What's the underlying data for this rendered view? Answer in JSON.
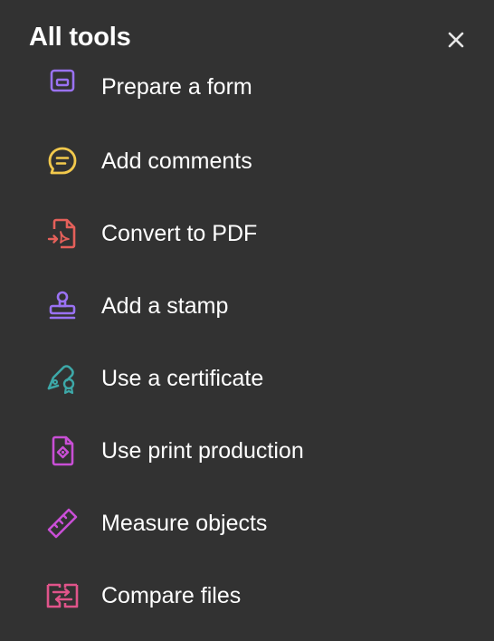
{
  "panel": {
    "title": "All tools",
    "close_icon": "close-icon"
  },
  "tools": [
    {
      "label": "Prepare a form",
      "icon": "prepare-form-icon",
      "color": "#9A72F3"
    },
    {
      "label": "Add comments",
      "icon": "comment-icon",
      "color": "#F2C94C"
    },
    {
      "label": "Convert to PDF",
      "icon": "convert-pdf-icon",
      "color": "#E5605A"
    },
    {
      "label": "Add a stamp",
      "icon": "stamp-icon",
      "color": "#9A72F3"
    },
    {
      "label": "Use a certificate",
      "icon": "certificate-icon",
      "color": "#3DA8A8"
    },
    {
      "label": "Use print production",
      "icon": "print-production-icon",
      "color": "#C94FD6"
    },
    {
      "label": "Measure objects",
      "icon": "ruler-icon",
      "color": "#C94FD6"
    },
    {
      "label": "Compare files",
      "icon": "compare-files-icon",
      "color": "#E0548A"
    }
  ]
}
